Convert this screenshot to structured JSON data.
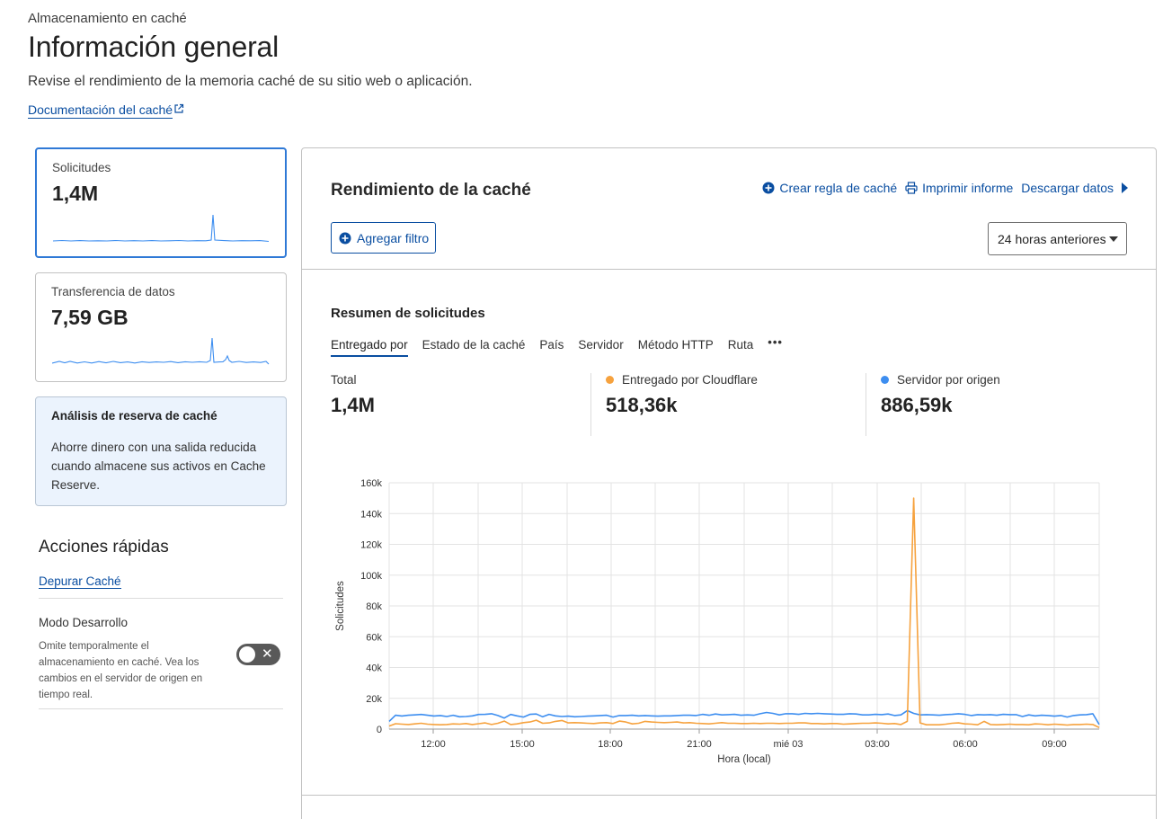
{
  "header": {
    "breadcrumb": "Almacenamiento en caché",
    "title": "Información general",
    "description": "Revise el rendimiento de la memoria caché de su sitio web o aplicación.",
    "doc_link": "Documentación del caché"
  },
  "metrics": {
    "requests": {
      "label": "Solicitudes",
      "value": "1,4M"
    },
    "transfer": {
      "label": "Transferencia de datos",
      "value": "7,59 GB"
    }
  },
  "cache_reserve": {
    "title": "Análisis de reserva de caché",
    "text": "Ahorre dinero con una salida reducida cuando almacene sus activos en Cache Reserve."
  },
  "quick_actions": {
    "title": "Acciones rápidas",
    "purge_link": "Depurar Caché",
    "dev_mode_title": "Modo Desarrollo",
    "dev_mode_desc": "Omite temporalmente el almacenamiento en caché. Vea los cambios en el servidor de origen en tiempo real.",
    "dev_mode_on": false
  },
  "panel": {
    "title": "Rendimiento de la caché",
    "actions": {
      "create_rule": "Crear regla de caché",
      "print": "Imprimir informe",
      "download": "Descargar datos"
    },
    "add_filter": "Agregar filtro",
    "time_range": "24 horas anteriores"
  },
  "summary": {
    "title": "Resumen de solicitudes",
    "tabs": [
      "Entregado por",
      "Estado de la caché",
      "País",
      "Servidor",
      "Método HTTP",
      "Ruta"
    ],
    "active_tab": "Entregado por",
    "stats": [
      {
        "label": "Total",
        "value": "1,4M"
      },
      {
        "label": "Entregado por Cloudflare",
        "value": "518,36k",
        "color": "#f6a23e"
      },
      {
        "label": "Servidor por origen",
        "value": "886,59k",
        "color": "#3d8ef0"
      }
    ]
  },
  "colors": {
    "accent": "#0a4ea1",
    "cloudflare": "#f6a23e",
    "origin": "#3d8ef0"
  },
  "chart_data": {
    "type": "line",
    "xlabel": "Hora (local)",
    "ylabel": "Solicitudes",
    "ylim": [
      0,
      160000
    ],
    "y_ticks": [
      "0",
      "20k",
      "40k",
      "60k",
      "80k",
      "100k",
      "120k",
      "140k",
      "160k"
    ],
    "x_ticks": [
      "12:00",
      "15:00",
      "18:00",
      "21:00",
      "mié 03",
      "03:00",
      "06:00",
      "09:00"
    ],
    "grid": true,
    "series": [
      {
        "name": "Servidor por origen",
        "color": "#3d8ef0",
        "values": [
          5000,
          9000,
          8500,
          9000,
          9200,
          9500,
          9000,
          8500,
          8800,
          8200,
          9000,
          8000,
          8200,
          8600,
          9500,
          9600,
          10000,
          8800,
          7200,
          9500,
          8600,
          7800,
          9600,
          9800,
          8000,
          9600,
          8600,
          8200,
          8400,
          8000,
          8200,
          8400,
          8600,
          8800,
          9000,
          7800,
          8800,
          8800,
          9000,
          8600,
          8800,
          8600,
          8400,
          8600,
          8600,
          8800,
          9000,
          9000,
          8800,
          9600,
          9000,
          9800,
          9200,
          9400,
          9600,
          9000,
          9200,
          9000,
          10000,
          10800,
          10200,
          9200,
          10000,
          10000,
          9600,
          10200,
          10000,
          10200,
          10000,
          9800,
          9600,
          9600,
          10000,
          9800,
          9200,
          9200,
          9600,
          9400,
          9800,
          8800,
          9200,
          12000,
          10200,
          9200,
          9400,
          9200,
          9000,
          9400,
          9600,
          10000,
          9600,
          8800,
          9400,
          9200,
          9400,
          9000,
          9600,
          9400,
          9400,
          8200,
          9200,
          8600,
          9000,
          8800,
          8400,
          8800,
          7800,
          8800,
          9200,
          9400,
          10000,
          3000
        ]
      },
      {
        "name": "Entregado por Cloudflare",
        "color": "#f6a23e",
        "values": [
          2000,
          3500,
          3200,
          3000,
          3400,
          3800,
          3200,
          3000,
          2800,
          3000,
          3400,
          3200,
          3600,
          3000,
          3500,
          4000,
          3000,
          3800,
          5200,
          3000,
          3400,
          4200,
          4600,
          5800,
          3800,
          4000,
          5000,
          5600,
          4000,
          4200,
          4000,
          3800,
          3600,
          4000,
          4200,
          3600,
          5200,
          4600,
          3400,
          3800,
          5000,
          4600,
          4400,
          4200,
          4400,
          4600,
          4000,
          4200,
          3800,
          3600,
          3400,
          3800,
          4200,
          3800,
          3800,
          3600,
          3600,
          3800,
          3600,
          3800,
          3800,
          3600,
          3800,
          3800,
          4000,
          4000,
          3600,
          3600,
          3400,
          3600,
          3600,
          3200,
          3400,
          3600,
          3800,
          3800,
          4000,
          3800,
          3400,
          3600,
          3000,
          5000,
          150000,
          4000,
          2800,
          2800,
          2800,
          3200,
          3800,
          4000,
          3400,
          3200,
          2800,
          5000,
          3000,
          2800,
          3000,
          3200,
          3000,
          3000,
          2800,
          3400,
          3200,
          2800,
          3200,
          3000,
          2600,
          3000,
          3000,
          3200,
          3000,
          1000
        ]
      }
    ]
  }
}
